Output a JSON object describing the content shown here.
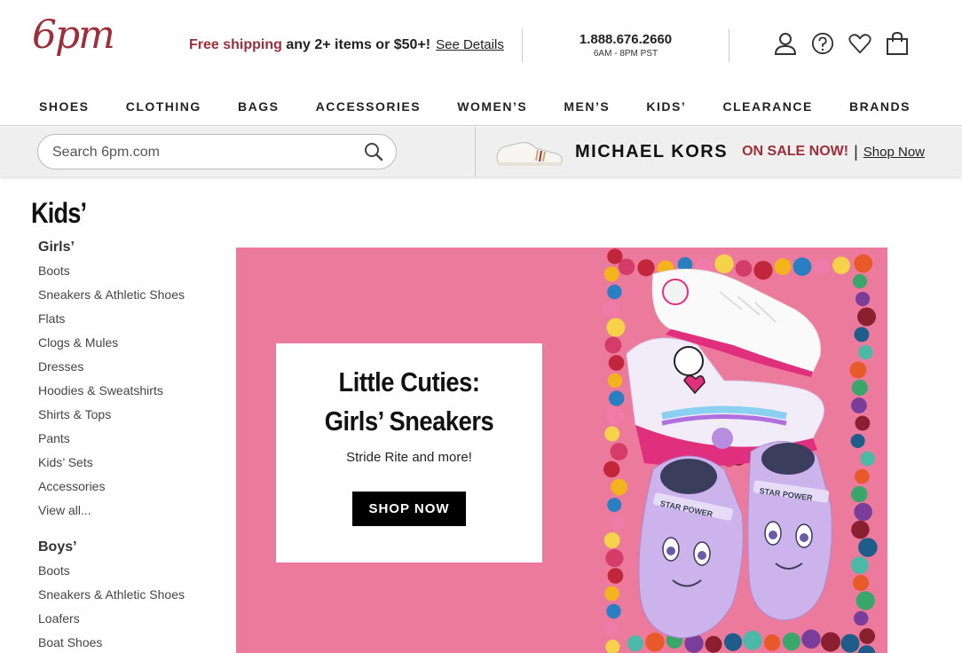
{
  "brand": {
    "logo_text": "6pm",
    "accent": "#9b2f3a"
  },
  "promo": {
    "highlight": "Free shipping",
    "rest": " any 2+ items or $50+!",
    "link": "See Details"
  },
  "contact": {
    "phone": "1.888.676.2660",
    "hours": "6AM - 8PM PST"
  },
  "header_icons": [
    "account-icon",
    "help-icon",
    "favorites-heart-icon",
    "cart-bag-icon"
  ],
  "nav": [
    "SHOES",
    "CLOTHING",
    "BAGS",
    "ACCESSORIES",
    "WOMEN’S",
    "MEN’S",
    "KIDS’",
    "CLEARANCE",
    "BRANDS"
  ],
  "search": {
    "placeholder": "Search 6pm.com"
  },
  "sale_banner": {
    "brand": "MICHAEL KORS",
    "sale": "ON SALE NOW!",
    "divider": "|",
    "link": "Shop Now"
  },
  "page": {
    "title": "Kids’"
  },
  "sidebar": {
    "girls": {
      "heading": "Girls’",
      "items": [
        "Boots",
        "Sneakers & Athletic Shoes",
        "Flats",
        "Clogs & Mules",
        "Dresses",
        "Hoodies & Sweatshirts",
        "Shirts & Tops",
        "Pants",
        "Kids’ Sets",
        "Accessories",
        "View all..."
      ]
    },
    "boys": {
      "heading": "Boys’",
      "items": [
        "Boots",
        "Sneakers & Athletic Shoes",
        "Loafers",
        "Boat Shoes"
      ]
    }
  },
  "hero": {
    "title": "Little Cuties: Girls’ Sneakers",
    "subtitle": "Stride Rite and more!",
    "cta": "SHOP NOW",
    "background": "#ec7a9c",
    "shoe_text": "STAR POWER"
  }
}
